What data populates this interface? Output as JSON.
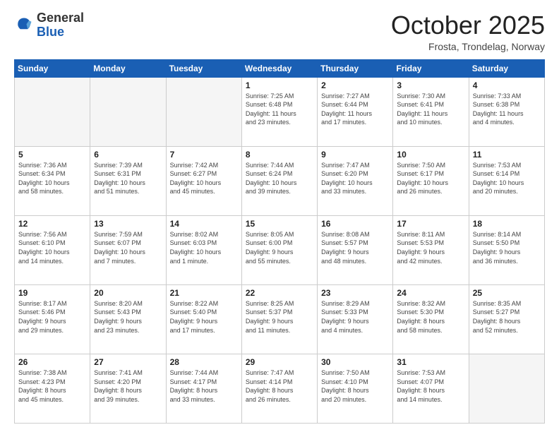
{
  "header": {
    "logo_general": "General",
    "logo_blue": "Blue",
    "month_title": "October 2025",
    "subtitle": "Frosta, Trondelag, Norway"
  },
  "weekdays": [
    "Sunday",
    "Monday",
    "Tuesday",
    "Wednesday",
    "Thursday",
    "Friday",
    "Saturday"
  ],
  "weeks": [
    [
      {
        "day": "",
        "info": ""
      },
      {
        "day": "",
        "info": ""
      },
      {
        "day": "",
        "info": ""
      },
      {
        "day": "1",
        "info": "Sunrise: 7:25 AM\nSunset: 6:48 PM\nDaylight: 11 hours\nand 23 minutes."
      },
      {
        "day": "2",
        "info": "Sunrise: 7:27 AM\nSunset: 6:44 PM\nDaylight: 11 hours\nand 17 minutes."
      },
      {
        "day": "3",
        "info": "Sunrise: 7:30 AM\nSunset: 6:41 PM\nDaylight: 11 hours\nand 10 minutes."
      },
      {
        "day": "4",
        "info": "Sunrise: 7:33 AM\nSunset: 6:38 PM\nDaylight: 11 hours\nand 4 minutes."
      }
    ],
    [
      {
        "day": "5",
        "info": "Sunrise: 7:36 AM\nSunset: 6:34 PM\nDaylight: 10 hours\nand 58 minutes."
      },
      {
        "day": "6",
        "info": "Sunrise: 7:39 AM\nSunset: 6:31 PM\nDaylight: 10 hours\nand 51 minutes."
      },
      {
        "day": "7",
        "info": "Sunrise: 7:42 AM\nSunset: 6:27 PM\nDaylight: 10 hours\nand 45 minutes."
      },
      {
        "day": "8",
        "info": "Sunrise: 7:44 AM\nSunset: 6:24 PM\nDaylight: 10 hours\nand 39 minutes."
      },
      {
        "day": "9",
        "info": "Sunrise: 7:47 AM\nSunset: 6:20 PM\nDaylight: 10 hours\nand 33 minutes."
      },
      {
        "day": "10",
        "info": "Sunrise: 7:50 AM\nSunset: 6:17 PM\nDaylight: 10 hours\nand 26 minutes."
      },
      {
        "day": "11",
        "info": "Sunrise: 7:53 AM\nSunset: 6:14 PM\nDaylight: 10 hours\nand 20 minutes."
      }
    ],
    [
      {
        "day": "12",
        "info": "Sunrise: 7:56 AM\nSunset: 6:10 PM\nDaylight: 10 hours\nand 14 minutes."
      },
      {
        "day": "13",
        "info": "Sunrise: 7:59 AM\nSunset: 6:07 PM\nDaylight: 10 hours\nand 7 minutes."
      },
      {
        "day": "14",
        "info": "Sunrise: 8:02 AM\nSunset: 6:03 PM\nDaylight: 10 hours\nand 1 minute."
      },
      {
        "day": "15",
        "info": "Sunrise: 8:05 AM\nSunset: 6:00 PM\nDaylight: 9 hours\nand 55 minutes."
      },
      {
        "day": "16",
        "info": "Sunrise: 8:08 AM\nSunset: 5:57 PM\nDaylight: 9 hours\nand 48 minutes."
      },
      {
        "day": "17",
        "info": "Sunrise: 8:11 AM\nSunset: 5:53 PM\nDaylight: 9 hours\nand 42 minutes."
      },
      {
        "day": "18",
        "info": "Sunrise: 8:14 AM\nSunset: 5:50 PM\nDaylight: 9 hours\nand 36 minutes."
      }
    ],
    [
      {
        "day": "19",
        "info": "Sunrise: 8:17 AM\nSunset: 5:46 PM\nDaylight: 9 hours\nand 29 minutes."
      },
      {
        "day": "20",
        "info": "Sunrise: 8:20 AM\nSunset: 5:43 PM\nDaylight: 9 hours\nand 23 minutes."
      },
      {
        "day": "21",
        "info": "Sunrise: 8:22 AM\nSunset: 5:40 PM\nDaylight: 9 hours\nand 17 minutes."
      },
      {
        "day": "22",
        "info": "Sunrise: 8:25 AM\nSunset: 5:37 PM\nDaylight: 9 hours\nand 11 minutes."
      },
      {
        "day": "23",
        "info": "Sunrise: 8:29 AM\nSunset: 5:33 PM\nDaylight: 9 hours\nand 4 minutes."
      },
      {
        "day": "24",
        "info": "Sunrise: 8:32 AM\nSunset: 5:30 PM\nDaylight: 8 hours\nand 58 minutes."
      },
      {
        "day": "25",
        "info": "Sunrise: 8:35 AM\nSunset: 5:27 PM\nDaylight: 8 hours\nand 52 minutes."
      }
    ],
    [
      {
        "day": "26",
        "info": "Sunrise: 7:38 AM\nSunset: 4:23 PM\nDaylight: 8 hours\nand 45 minutes."
      },
      {
        "day": "27",
        "info": "Sunrise: 7:41 AM\nSunset: 4:20 PM\nDaylight: 8 hours\nand 39 minutes."
      },
      {
        "day": "28",
        "info": "Sunrise: 7:44 AM\nSunset: 4:17 PM\nDaylight: 8 hours\nand 33 minutes."
      },
      {
        "day": "29",
        "info": "Sunrise: 7:47 AM\nSunset: 4:14 PM\nDaylight: 8 hours\nand 26 minutes."
      },
      {
        "day": "30",
        "info": "Sunrise: 7:50 AM\nSunset: 4:10 PM\nDaylight: 8 hours\nand 20 minutes."
      },
      {
        "day": "31",
        "info": "Sunrise: 7:53 AM\nSunset: 4:07 PM\nDaylight: 8 hours\nand 14 minutes."
      },
      {
        "day": "",
        "info": ""
      }
    ]
  ]
}
